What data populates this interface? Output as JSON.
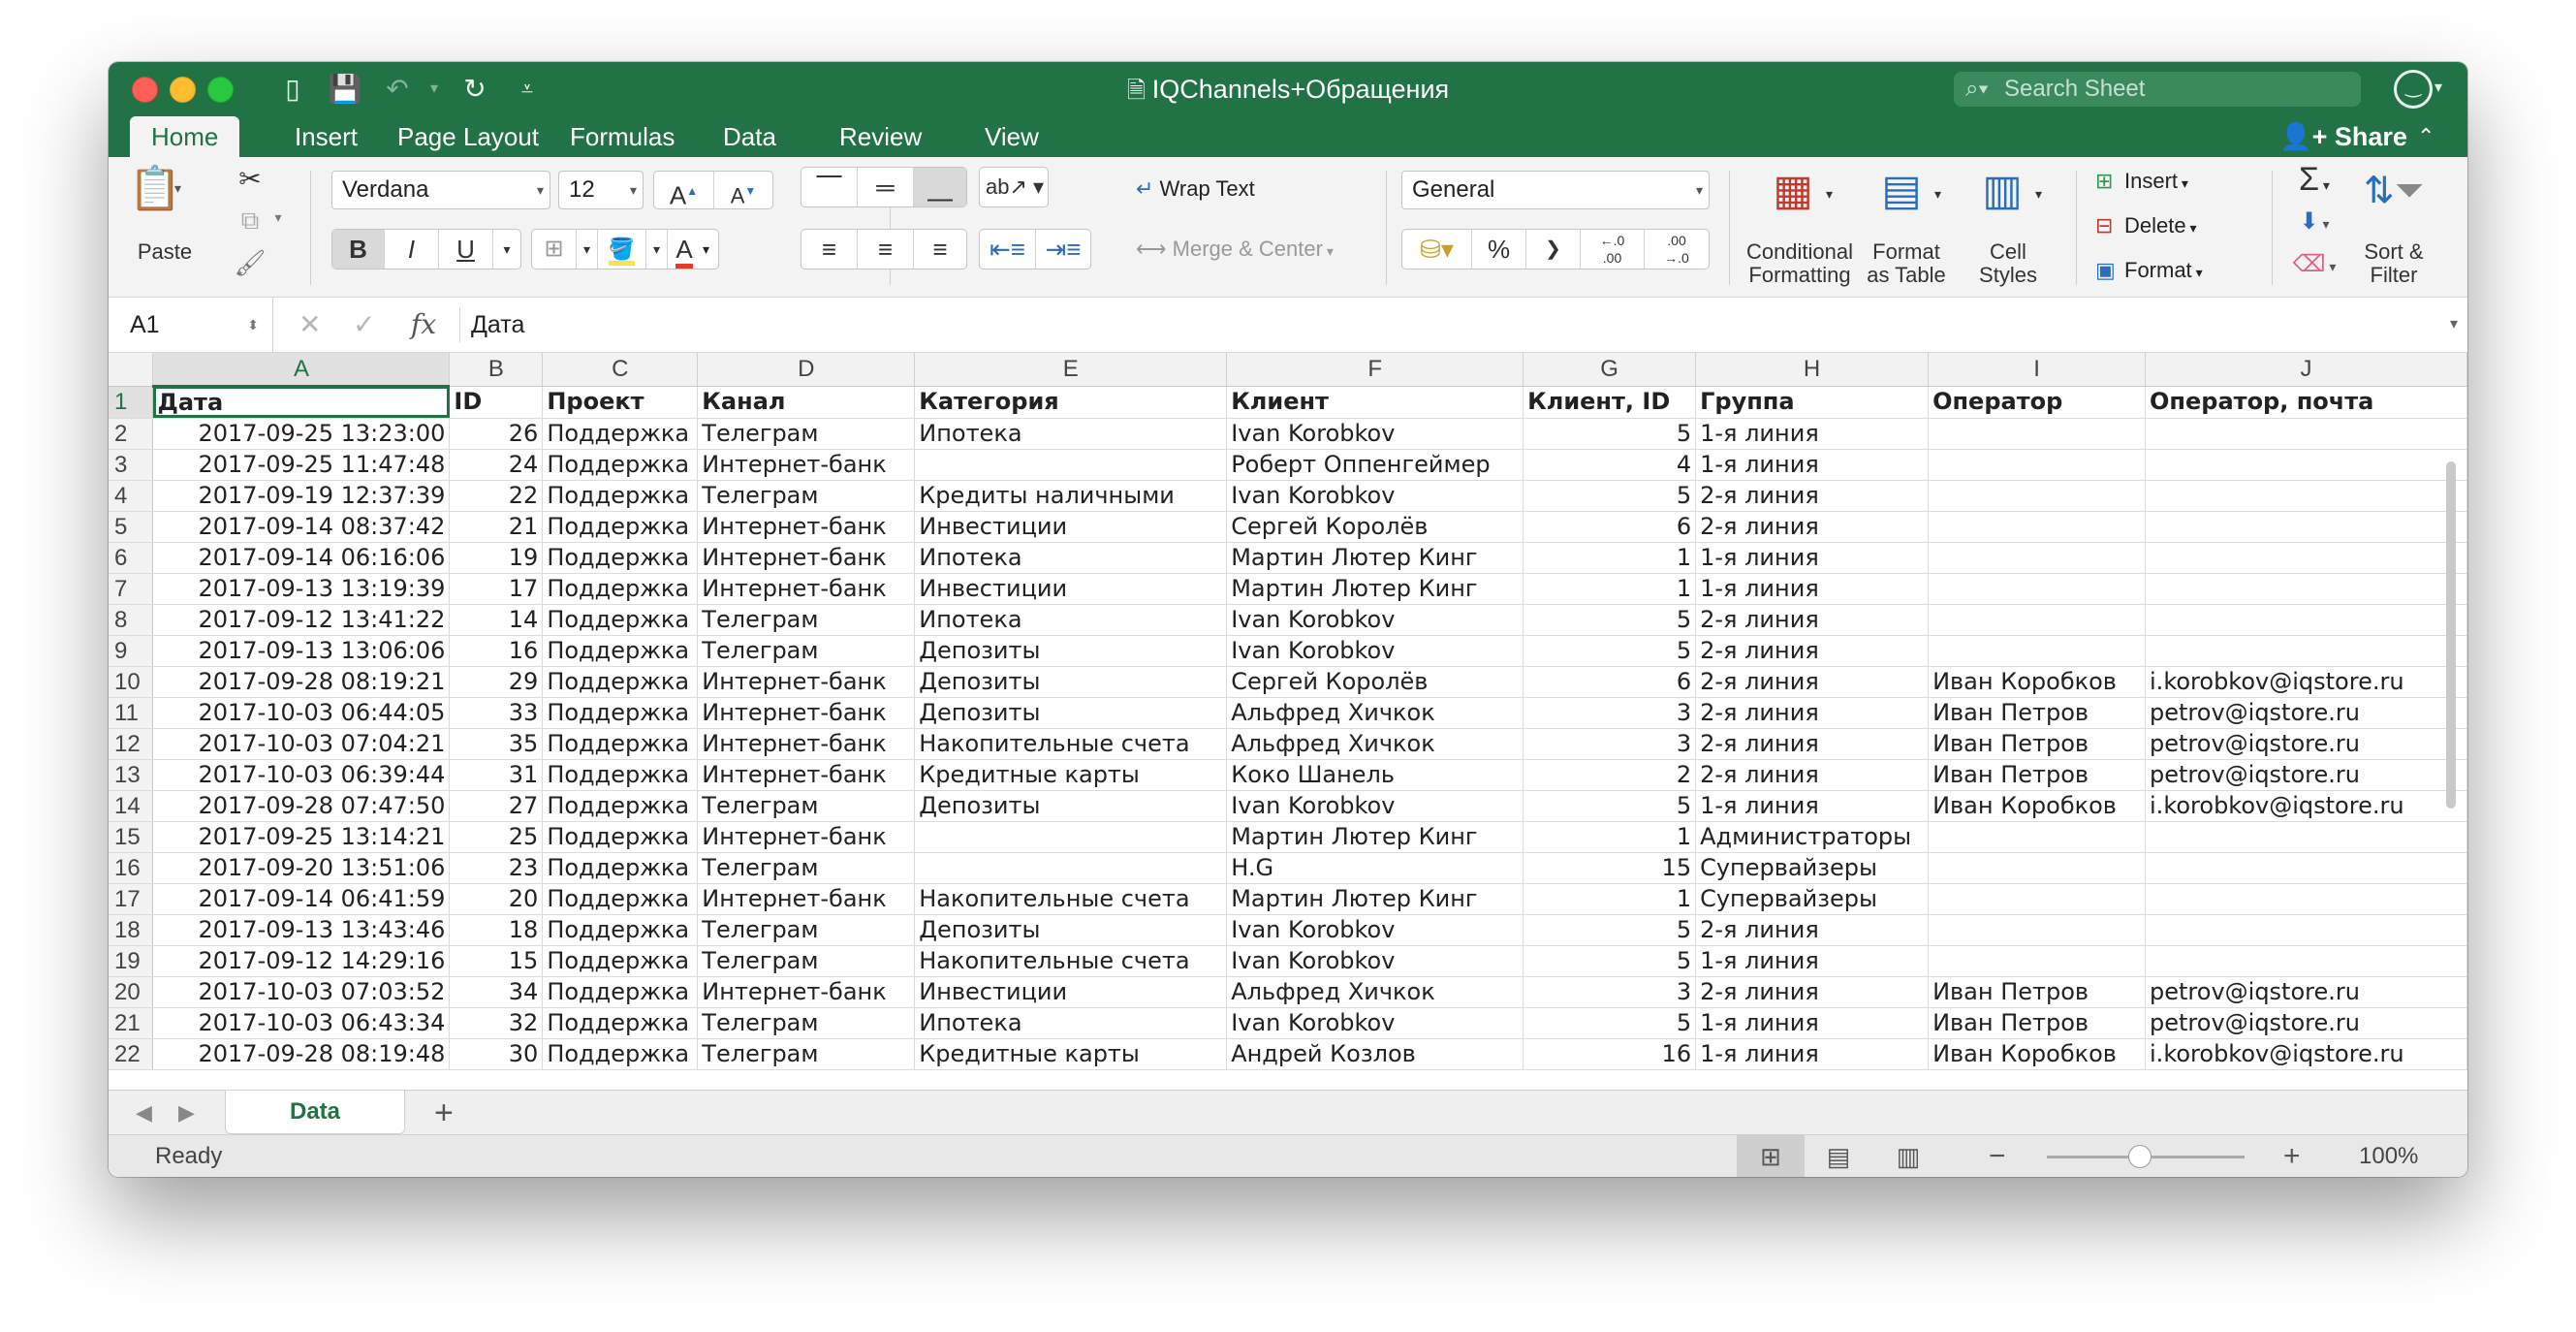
{
  "window": {
    "title": "IQChannels+Обращения"
  },
  "search": {
    "placeholder": "Search Sheet"
  },
  "ribbon_tabs": [
    "Home",
    "Insert",
    "Page Layout",
    "Formulas",
    "Data",
    "Review",
    "View"
  ],
  "share_label": "Share",
  "ribbon": {
    "paste": "Paste",
    "font_name": "Verdana",
    "font_size": "12",
    "bold": "B",
    "italic": "I",
    "underline": "U",
    "wrap_text": "Wrap Text",
    "merge_center": "Merge & Center",
    "number_format": "General",
    "percent": "%",
    "comma": "❯",
    "inc_decimal": "←.0\n.00",
    "dec_decimal": ".00\n→.0",
    "conditional": [
      "Conditional",
      "Formatting"
    ],
    "format_table": [
      "Format",
      "as Table"
    ],
    "cell_styles": [
      "Cell",
      "Styles"
    ],
    "insert": "Insert",
    "delete": "Delete",
    "format": "Format",
    "sort_filter": [
      "Sort &",
      "Filter"
    ]
  },
  "formula_bar": {
    "name_box": "A1",
    "fx": "fx",
    "value": "Дата"
  },
  "columns": [
    "A",
    "B",
    "C",
    "D",
    "E",
    "F",
    "G",
    "H",
    "I",
    "J"
  ],
  "header_row": [
    "Дата",
    "ID",
    "Проект",
    "Канал",
    "Категория",
    "Клиент",
    "Клиент, ID",
    "Группа",
    "Оператор",
    "Оператор, почта"
  ],
  "rows": [
    [
      "2017-09-25 13:23:00",
      "26",
      "Поддержка",
      "Телеграм",
      "Ипотека",
      "Ivan Korobkov",
      "5",
      "1-я линия",
      "",
      ""
    ],
    [
      "2017-09-25 11:47:48",
      "24",
      "Поддержка",
      "Интернет-банк",
      "",
      "Роберт Оппенгеймер",
      "4",
      "1-я линия",
      "",
      ""
    ],
    [
      "2017-09-19 12:37:39",
      "22",
      "Поддержка",
      "Телеграм",
      "Кредиты наличными",
      "Ivan Korobkov",
      "5",
      "2-я линия",
      "",
      ""
    ],
    [
      "2017-09-14 08:37:42",
      "21",
      "Поддержка",
      "Интернет-банк",
      "Инвестиции",
      "Сергей Королёв",
      "6",
      "2-я линия",
      "",
      ""
    ],
    [
      "2017-09-14 06:16:06",
      "19",
      "Поддержка",
      "Интернет-банк",
      "Ипотека",
      "Мартин Лютер Кинг",
      "1",
      "1-я линия",
      "",
      ""
    ],
    [
      "2017-09-13 13:19:39",
      "17",
      "Поддержка",
      "Интернет-банк",
      "Инвестиции",
      "Мартин Лютер Кинг",
      "1",
      "1-я линия",
      "",
      ""
    ],
    [
      "2017-09-12 13:41:22",
      "14",
      "Поддержка",
      "Телеграм",
      "Ипотека",
      "Ivan Korobkov",
      "5",
      "2-я линия",
      "",
      ""
    ],
    [
      "2017-09-13 13:06:06",
      "16",
      "Поддержка",
      "Телеграм",
      "Депозиты",
      "Ivan Korobkov",
      "5",
      "2-я линия",
      "",
      ""
    ],
    [
      "2017-09-28 08:19:21",
      "29",
      "Поддержка",
      "Интернет-банк",
      "Депозиты",
      "Сергей Королёв",
      "6",
      "2-я линия",
      "Иван Коробков",
      "i.korobkov@iqstore.ru"
    ],
    [
      "2017-10-03 06:44:05",
      "33",
      "Поддержка",
      "Интернет-банк",
      "Депозиты",
      "Альфред Хичкок",
      "3",
      "2-я линия",
      "Иван Петров",
      "petrov@iqstore.ru"
    ],
    [
      "2017-10-03 07:04:21",
      "35",
      "Поддержка",
      "Интернет-банк",
      "Накопительные счета",
      "Альфред Хичкок",
      "3",
      "2-я линия",
      "Иван Петров",
      "petrov@iqstore.ru"
    ],
    [
      "2017-10-03 06:39:44",
      "31",
      "Поддержка",
      "Интернет-банк",
      "Кредитные карты",
      "Коко Шанель",
      "2",
      "2-я линия",
      "Иван Петров",
      "petrov@iqstore.ru"
    ],
    [
      "2017-09-28 07:47:50",
      "27",
      "Поддержка",
      "Телеграм",
      "Депозиты",
      "Ivan Korobkov",
      "5",
      "1-я линия",
      "Иван Коробков",
      "i.korobkov@iqstore.ru"
    ],
    [
      "2017-09-25 13:14:21",
      "25",
      "Поддержка",
      "Интернет-банк",
      "",
      "Мартин Лютер Кинг",
      "1",
      "Администраторы",
      "",
      ""
    ],
    [
      "2017-09-20 13:51:06",
      "23",
      "Поддержка",
      "Телеграм",
      "",
      "H.G",
      "15",
      "Супервайзеры",
      "",
      ""
    ],
    [
      "2017-09-14 06:41:59",
      "20",
      "Поддержка",
      "Интернет-банк",
      "Накопительные счета",
      "Мартин Лютер Кинг",
      "1",
      "Супервайзеры",
      "",
      ""
    ],
    [
      "2017-09-13 13:43:46",
      "18",
      "Поддержка",
      "Телеграм",
      "Депозиты",
      "Ivan Korobkov",
      "5",
      "2-я линия",
      "",
      ""
    ],
    [
      "2017-09-12 14:29:16",
      "15",
      "Поддержка",
      "Телеграм",
      "Накопительные счета",
      "Ivan Korobkov",
      "5",
      "1-я линия",
      "",
      ""
    ],
    [
      "2017-10-03 07:03:52",
      "34",
      "Поддержка",
      "Интернет-банк",
      "Инвестиции",
      "Альфред Хичкок",
      "3",
      "2-я линия",
      "Иван Петров",
      "petrov@iqstore.ru"
    ],
    [
      "2017-10-03 06:43:34",
      "32",
      "Поддержка",
      "Телеграм",
      "Ипотека",
      "Ivan Korobkov",
      "5",
      "1-я линия",
      "Иван Петров",
      "petrov@iqstore.ru"
    ],
    [
      "2017-09-28 08:19:48",
      "30",
      "Поддержка",
      "Телеграм",
      "Кредитные карты",
      "Андрей Козлов",
      "16",
      "1-я линия",
      "Иван Коробков",
      "i.korobkov@iqstore.ru"
    ]
  ],
  "sheet_tabs": [
    "Data"
  ],
  "add_sheet": "+",
  "status": {
    "ready": "Ready",
    "zoom": "100%",
    "minus": "−",
    "plus": "+"
  },
  "colors": {
    "excel_green": "#217346",
    "grid": "#dcdcdc"
  }
}
